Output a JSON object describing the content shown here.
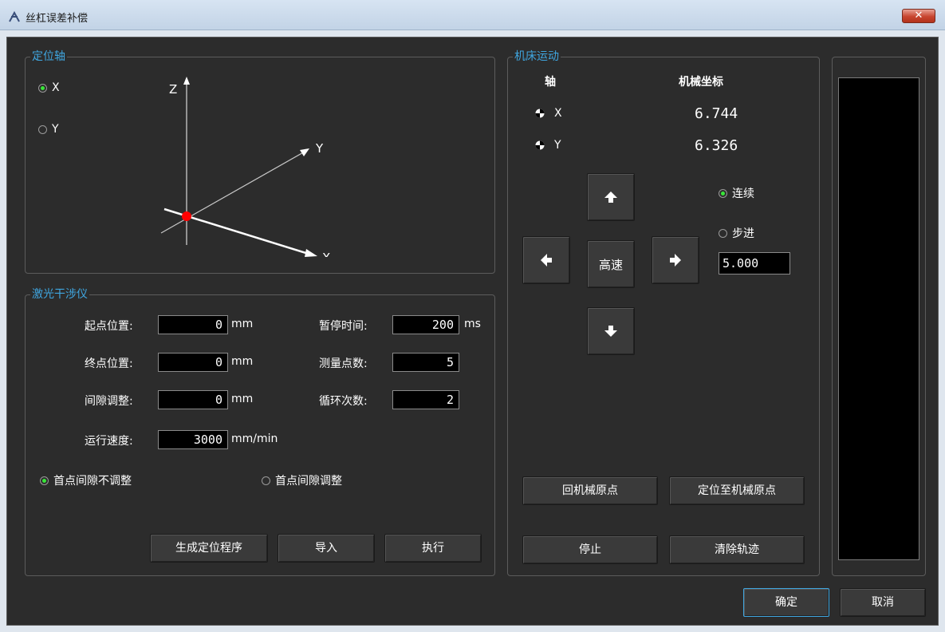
{
  "window": {
    "title": "丝杠误差补偿",
    "close_label": "✕"
  },
  "positioning_axis": {
    "title": "定位轴",
    "options": [
      {
        "label": "X",
        "selected": true
      },
      {
        "label": "Y",
        "selected": false
      }
    ],
    "diagram": {
      "z": "Z",
      "y": "Y",
      "x": "X"
    }
  },
  "laser": {
    "title": "激光干涉仪",
    "fields": {
      "start_label": "起点位置:",
      "start_value": "0",
      "start_unit": "mm",
      "end_label": "终点位置:",
      "end_value": "0",
      "end_unit": "mm",
      "gap_label": "间隙调整:",
      "gap_value": "0",
      "gap_unit": "mm",
      "speed_label": "运行速度:",
      "speed_value": "3000",
      "speed_unit": "mm/min",
      "pause_label": "暂停时间:",
      "pause_value": "200",
      "pause_unit": "ms",
      "points_label": "测量点数:",
      "points_value": "5",
      "cycles_label": "循环次数:",
      "cycles_value": "2"
    },
    "radio_no_adjust": {
      "label": "首点间隙不调整",
      "selected": true
    },
    "radio_adjust": {
      "label": "首点间隙调整",
      "selected": false
    },
    "buttons": {
      "generate": "生成定位程序",
      "import": "导入",
      "execute": "执行"
    }
  },
  "machine": {
    "title": "机床运动",
    "axis_header": "轴",
    "coord_header": "机械坐标",
    "axes": [
      {
        "label": "X",
        "value": "6.744"
      },
      {
        "label": "Y",
        "value": "6.326"
      }
    ],
    "jog": {
      "speed_label": "高速"
    },
    "mode_continuous": {
      "label": "连续",
      "selected": true
    },
    "mode_step": {
      "label": "步进",
      "selected": false
    },
    "step_value": "5.000",
    "buttons": {
      "home": "回机械原点",
      "goto_origin": "定位至机械原点",
      "stop": "停止",
      "clear_track": "清除轨迹"
    }
  },
  "footer": {
    "ok": "确定",
    "cancel": "取消"
  },
  "colors": {
    "accent": "#3fa6e0",
    "radio_on": "#39e639",
    "bg": "#2c2c2c",
    "point": "#ff0000"
  }
}
